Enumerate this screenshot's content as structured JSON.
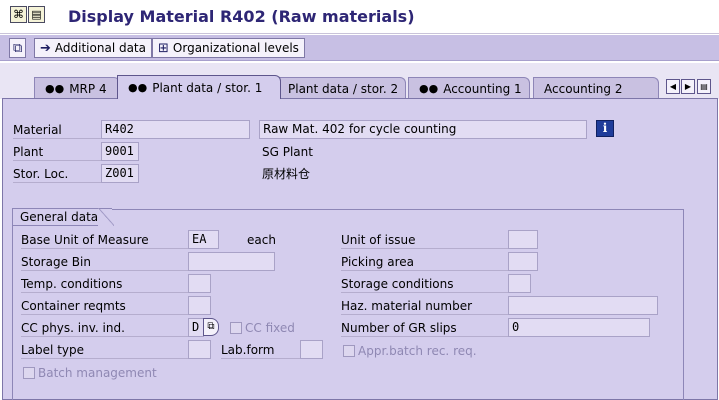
{
  "title": {
    "text": "Display Material R402 (Raw materials)"
  },
  "toolbar": {
    "additional_data": "Additional data",
    "org_levels": "Organizational levels"
  },
  "tabs": [
    {
      "label": "MRP 4",
      "icon": "glasses-icon"
    },
    {
      "label": "Plant data / stor. 1",
      "icon": "glasses-icon",
      "active": true
    },
    {
      "label": "Plant data / stor. 2"
    },
    {
      "label": "Accounting 1",
      "icon": "glasses-icon"
    },
    {
      "label": "Accounting 2"
    }
  ],
  "header": {
    "material_label": "Material",
    "material_value": "R402",
    "material_desc": "Raw Mat. 402 for cycle counting",
    "plant_label": "Plant",
    "plant_value": "9001",
    "plant_desc": "SG Plant",
    "stor_label": "Stor. Loc.",
    "stor_value": "Z001",
    "stor_desc": "原材料仓"
  },
  "general": {
    "title": "General data",
    "base_uom_label": "Base Unit of Measure",
    "base_uom_value": "EA",
    "base_uom_text": "each",
    "storage_bin_label": "Storage Bin",
    "storage_bin_value": "",
    "temp_label": "Temp. conditions",
    "temp_value": "",
    "container_label": "Container reqmts",
    "container_value": "",
    "cc_label": "CC phys. inv. ind.",
    "cc_value": "D",
    "cc_fixed_label": "CC fixed",
    "label_type_label": "Label type",
    "label_type_value": "",
    "lab_form_label": "Lab.form",
    "lab_form_value": "",
    "batch_mgmt_label": "Batch management",
    "unit_issue_label": "Unit of issue",
    "unit_issue_value": "",
    "picking_label": "Picking area",
    "picking_value": "",
    "storage_cond_label": "Storage conditions",
    "storage_cond_value": "",
    "haz_label": "Haz. material number",
    "haz_value": "",
    "gr_slips_label": "Number of GR slips",
    "gr_slips_value": "0",
    "appr_batch_label": "Appr.batch rec. req."
  },
  "colors": {
    "title_text": "#2e2675",
    "toolbar_bg": "#c7bfe4",
    "panel_bg": "#d4cded",
    "field_bg": "#e2dcf3"
  }
}
